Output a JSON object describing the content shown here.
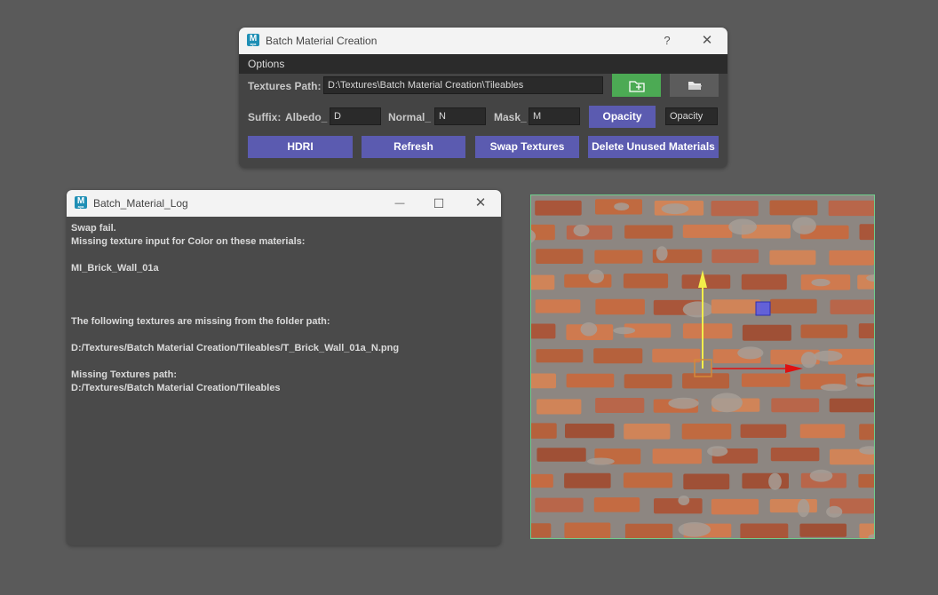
{
  "batch_window": {
    "title": "Batch Material Creation",
    "icon_letter": "M",
    "icon_sub": "aya",
    "help_label": "?",
    "close_label": "✕",
    "menu": {
      "options": "Options"
    },
    "textures_path": {
      "label": "Textures Path:",
      "value": "D:\\Textures\\Batch Material Creation\\Tileables"
    },
    "suffix": {
      "label": "Suffix:",
      "albedo_label": "Albedo_",
      "albedo_value": "D",
      "normal_label": "Normal_",
      "normal_value": "N",
      "mask_label": "Mask_",
      "mask_value": "M",
      "opacity_button": "Opacity",
      "opacity_value": "Opacity"
    },
    "buttons": {
      "hdri": "HDRI",
      "refresh": "Refresh",
      "swap_textures": "Swap Textures",
      "delete_unused": "Delete Unused Materials"
    },
    "colors": {
      "accent_purple": "#5b5bb0",
      "accent_green": "#4caa54"
    }
  },
  "log_window": {
    "title": "Batch_Material_Log",
    "minimize_label": "—",
    "maximize_label": "☐",
    "close_label": "✕",
    "lines": [
      "Swap fail.",
      "Missing texture input for Color on these materials:",
      "",
      "MI_Brick_Wall_01a",
      "",
      "",
      "",
      "The following textures are missing from the folder path:",
      "",
      "D:/Textures/Batch Material Creation/Tileables/T_Brick_Wall_01a_N.png",
      "",
      "Missing Textures path:",
      "D:/Textures/Batch Material Creation/Tileables"
    ]
  },
  "viewport": {
    "material": "brick-wall",
    "gizmo_colors": {
      "x_axis": "#e01010",
      "y_axis": "#f2ee4a",
      "plane_handle": "#5a5ae8",
      "center": "#d38a3a"
    }
  }
}
